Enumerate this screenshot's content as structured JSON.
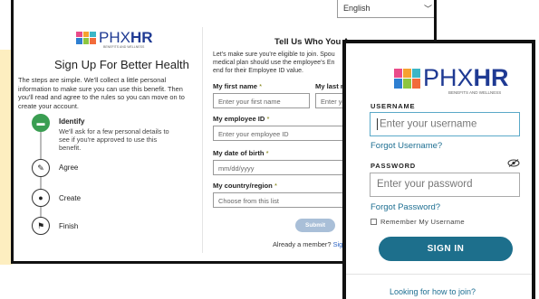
{
  "colors": {
    "accent_yellow": "#fdeec0",
    "step_active": "#3a9e52",
    "submit_disabled": "#a9bfd8",
    "signin": "#1d6f8c",
    "link": "#1e6f92",
    "logo_text": "#1f3a93",
    "logo_blocks": [
      "#e94b8a",
      "#f6a12f",
      "#3bb6c6",
      "#2e7fd1",
      "#8dc63f",
      "#f26b3a"
    ]
  },
  "signup": {
    "language_selected": "English",
    "logo": {
      "prefix": "PHX",
      "brand": "HR",
      "tagline": "BENEFITS AND WELLNESS"
    },
    "title": "Sign Up For Better Health",
    "intro": "The steps are simple. We'll collect a little personal information to make sure you can use this benefit. Then you'll read and agree to the rules so you can move on to create your account.",
    "steps": [
      {
        "label": "Identify",
        "description": "We'll ask for a few personal details to see if you're approved to use this benefit.",
        "icon": "id-card-icon",
        "glyph": "▬"
      },
      {
        "label": "Agree",
        "description": "",
        "icon": "pen-icon",
        "glyph": "✎"
      },
      {
        "label": "Create",
        "description": "",
        "icon": "user-icon",
        "glyph": "●"
      },
      {
        "label": "Finish",
        "description": "",
        "icon": "flag-icon",
        "glyph": "⚑"
      }
    ],
    "form": {
      "title": "Tell Us Who You A",
      "intro_lines": [
        "Let's make sure you're eligible to join. Spou",
        "medical plan should use the employee's En",
        "end for their Employee ID value."
      ],
      "first_name": {
        "label": "My first name",
        "placeholder": "Enter your first name"
      },
      "last_name": {
        "label": "My last na",
        "placeholder": "Enter yo"
      },
      "employee_id": {
        "label": "My employee ID",
        "placeholder": "Enter your employee ID"
      },
      "dob": {
        "label": "My date of birth",
        "placeholder": "mm/dd/yyyy"
      },
      "country": {
        "label": "My country/region",
        "placeholder": "Choose from this list"
      },
      "required_mark": "*",
      "submit_label": "Submit",
      "member_text": "Already a member?",
      "member_link": "Sig"
    }
  },
  "login": {
    "logo": {
      "prefix": "PHX",
      "brand": "HR",
      "tagline": "BENEFITS AND WELLNESS"
    },
    "username_label": "USERNAME",
    "username_placeholder": "Enter your username",
    "forgot_username": "Forgot Username?",
    "password_label": "PASSWORD",
    "password_placeholder": "Enter your password",
    "forgot_password": "Forgot Password?",
    "remember_label": "Remember My Username",
    "signin_label": "SIGN IN",
    "join_link": "Looking for how to join?"
  }
}
